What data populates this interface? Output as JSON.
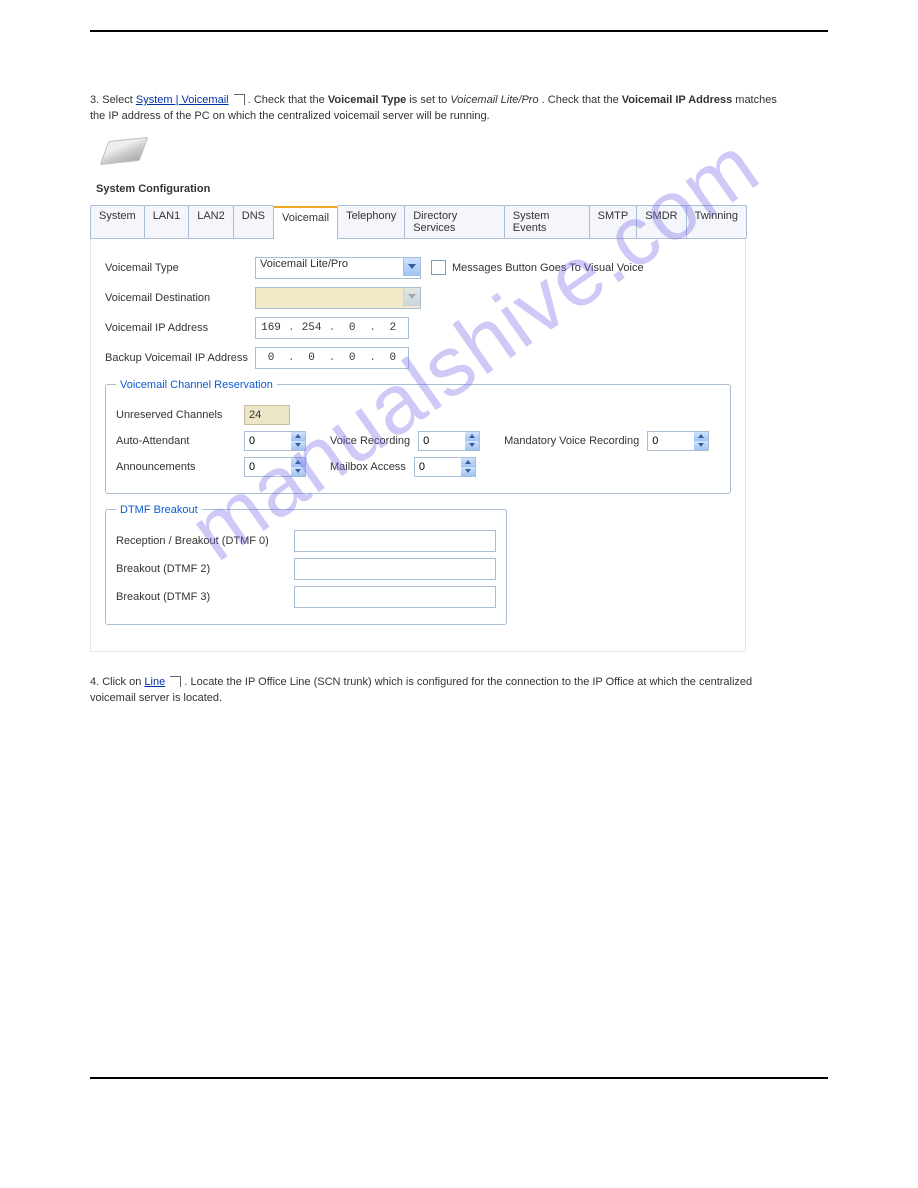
{
  "watermark": "manualshive.com",
  "intro_prefix": "3. Select ",
  "intro_link": "System | Voicemail",
  "intro_suffix_a": ". Check that the ",
  "intro_bold_a": "Voicemail Type",
  "intro_suffix_b": " is set to ",
  "intro_em": "Voicemail Lite/Pro",
  "intro_suffix_c": ". Check that the ",
  "intro_bold_b": "Voicemail IP Address",
  "intro_suffix_d": " matches the IP address of the PC on which the centralized voicemail server will be running.",
  "system_config": "System Configuration",
  "tabs": {
    "system": "System",
    "lan1": "LAN1",
    "lan2": "LAN2",
    "dns": "DNS",
    "voicemail": "Voicemail",
    "telephony": "Telephony",
    "directory": "Directory Services",
    "events": "System Events",
    "smtp": "SMTP",
    "smdr": "SMDR",
    "twinning": "Twinning"
  },
  "labels": {
    "vm_type": "Voicemail Type",
    "vm_dest": "Voicemail Destination",
    "vm_ip": "Voicemail IP Address",
    "backup_ip": "Backup Voicemail IP Address",
    "msgs_visual": "Messages Button Goes To Visual Voice",
    "group1": "Voicemail Channel Reservation",
    "unreserved": "Unreserved Channels",
    "auto_att": "Auto-Attendant",
    "voice_rec": "Voice Recording",
    "mandatory": "Mandatory Voice Recording",
    "announcements": "Announcements",
    "mailbox": "Mailbox Access",
    "group2": "DTMF Breakout",
    "dtmf0": "Reception / Breakout (DTMF 0)",
    "dtmf2": "Breakout (DTMF 2)",
    "dtmf3": "Breakout (DTMF 3)"
  },
  "values": {
    "vm_type_value": "Voicemail Lite/Pro",
    "ip_a": "169",
    "ip_b": "254",
    "ip_c": "0",
    "ip_d": "2",
    "bip_a": "0",
    "bip_b": "0",
    "bip_c": "0",
    "bip_d": "0",
    "unreserved": "24",
    "auto_att": "0",
    "voice_rec": "0",
    "mandatory": "0",
    "announcements": "0",
    "mailbox": "0"
  },
  "bottom": {
    "prefix": "4. Click on ",
    "link": "Line",
    "suffix": ". Locate the IP Office Line (SCN trunk) which is configured for the connection to the IP Office at which the centralized voicemail server is located."
  }
}
